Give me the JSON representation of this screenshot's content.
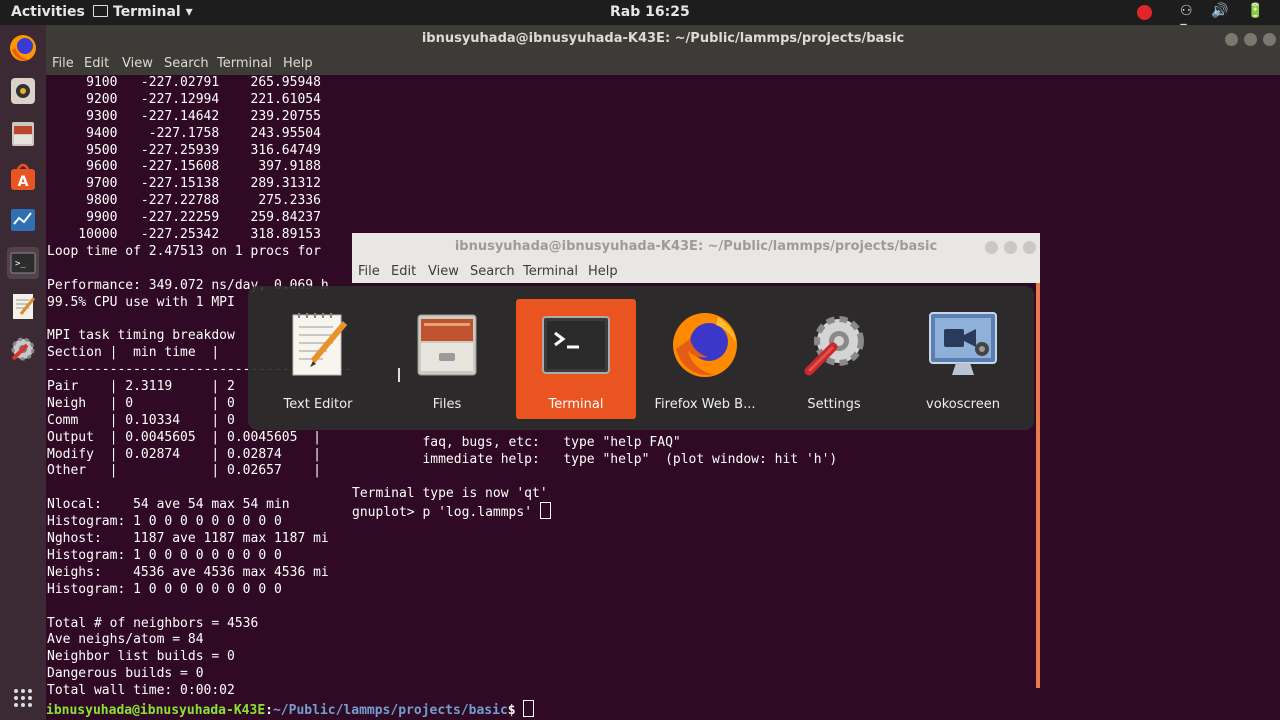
{
  "topbar": {
    "activities": "Activities",
    "app_menu": "Terminal ▾",
    "clock": "Rab 16:25",
    "tray": "⚇ 🔊 🔋 ▾"
  },
  "main_terminal": {
    "title": "ibnusyuhada@ibnusyuhada-K43E: ~/Public/lammps/projects/basic",
    "menu": [
      "File",
      "Edit",
      "View",
      "Search",
      "Terminal",
      "Help"
    ],
    "lines": [
      "     9100   -227.02791    265.95948",
      "     9200   -227.12994    221.61054",
      "     9300   -227.14642    239.20755",
      "     9400    -227.1758    243.95504",
      "     9500   -227.25939    316.64749",
      "     9600   -227.15608     397.9188",
      "     9700   -227.15138    289.31312",
      "     9800   -227.22788     275.2336",
      "     9900   -227.22259    259.84237",
      "    10000   -227.25342    318.89153",
      "Loop time of 2.47513 on 1 procs for",
      "",
      "Performance: 349.072 ns/day, 0.069 h",
      "99.5% CPU use with 1 MPI",
      "",
      "MPI task timing breakdow",
      "Section |  min time  |",
      "---------------------------------------",
      "Pair    | 2.3119     | 2",
      "Neigh   | 0          | 0",
      "Comm    | 0.10334    | 0",
      "Output  | 0.0045605  | 0.0045605  |",
      "Modify  | 0.02874    | 0.02874    |",
      "Other   |            | 0.02657    |",
      "",
      "Nlocal:    54 ave 54 max 54 min",
      "Histogram: 1 0 0 0 0 0 0 0 0 0",
      "Nghost:    1187 ave 1187 max 1187 mi",
      "Histogram: 1 0 0 0 0 0 0 0 0 0",
      "Neighs:    4536 ave 4536 max 4536 mi",
      "Histogram: 1 0 0 0 0 0 0 0 0 0",
      "",
      "Total # of neighbors = 4536",
      "Ave neighs/atom = 84",
      "Neighbor list builds = 0",
      "Dangerous builds = 0",
      "Total wall time: 0:00:02"
    ],
    "prompt_user": "ibnusyuhada@ibnusyuhada-K43E",
    "prompt_path": "~/Public/lammps/projects/basic",
    "prompt_symbol": "$ "
  },
  "second_terminal": {
    "title": "ibnusyuhada@ibnusyuhada-K43E: ~/Public/lammps/projects/basic",
    "menu": [
      "File",
      "Edit",
      "View",
      "Search",
      "Terminal",
      "Help"
    ],
    "lines": [
      "         faq, bugs, etc:   type \"help FAQ\"",
      "         immediate help:   type \"help\"  (plot window: hit 'h')",
      "",
      "Terminal type is now 'qt'"
    ],
    "input_prompt": "gnuplot> ",
    "input_value": "p 'log.lammps' "
  },
  "switcher": {
    "items": [
      {
        "label": "Text Editor",
        "icon": "text-editor-icon"
      },
      {
        "label": "Files",
        "icon": "files-icon"
      },
      {
        "label": "Terminal",
        "icon": "terminal-icon",
        "selected": true
      },
      {
        "label": "Firefox Web B...",
        "icon": "firefox-icon"
      },
      {
        "label": "Settings",
        "icon": "settings-icon"
      },
      {
        "label": "vokoscreen",
        "icon": "vokoscreen-icon"
      }
    ]
  },
  "colors": {
    "terminal_bg": "#300a24",
    "accent": "#e95420",
    "prompt_user": "#8ae234",
    "prompt_path": "#729fcf"
  }
}
